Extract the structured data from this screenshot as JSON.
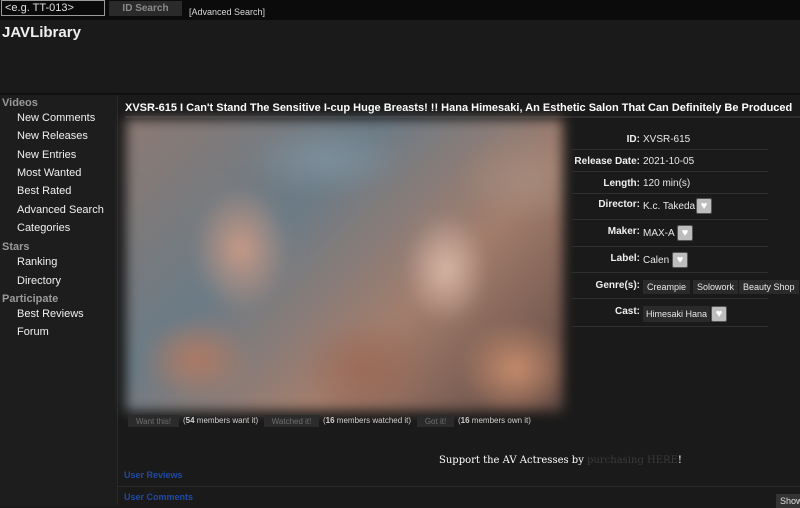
{
  "search": {
    "placeholder": "<e.g. TT-013>",
    "button": "ID Search",
    "advanced": "[Advanced Search]"
  },
  "site": {
    "logo": "JAVLibrary"
  },
  "sidebar": {
    "videos_head": "Videos",
    "videos": [
      "New Comments",
      "New Releases",
      "New Entries",
      "Most Wanted",
      "Best Rated",
      "Advanced Search",
      "Categories"
    ],
    "stars_head": "Stars",
    "stars": [
      "Ranking",
      "Directory"
    ],
    "participate_head": "Participate",
    "participate": [
      "Best Reviews",
      "Forum"
    ]
  },
  "video": {
    "title": "XVSR-615 I Can't Stand The Sensitive I-cup Huge Breasts! !! Hana Himesaki, An Esthetic Salon That Can Definitely Be Produced",
    "labels": {
      "id": "ID:",
      "release": "Release Date:",
      "length": "Length:",
      "director": "Director:",
      "maker": "Maker:",
      "label": "Label:",
      "genres": "Genre(s):",
      "cast": "Cast:"
    },
    "id": "XVSR-615",
    "release": "2021-10-05",
    "length": "120 min(s)",
    "director": "K.c. Takeda",
    "maker": "MAX-A",
    "label": "Calen",
    "genres": [
      "Creampie",
      "Solowork",
      "Beauty Shop"
    ],
    "cast": "Himesaki Hana"
  },
  "actions": {
    "want_btn": "Want this!",
    "want_count": "54",
    "want_text": " members want it)",
    "watched_btn": "Watched it!",
    "watched_count": "16",
    "watched_text": " members watched it)",
    "own_btn": "Got it!",
    "own_count": "16",
    "own_text": " members own it)"
  },
  "support": {
    "prefix": "Support the AV Actresses by ",
    "link": "purchasing HERE",
    "suffix": "!"
  },
  "bottom": {
    "reviews": "User Reviews",
    "comments": "User Comments",
    "show": "Show"
  },
  "icons": {
    "heart": "heart-icon"
  }
}
